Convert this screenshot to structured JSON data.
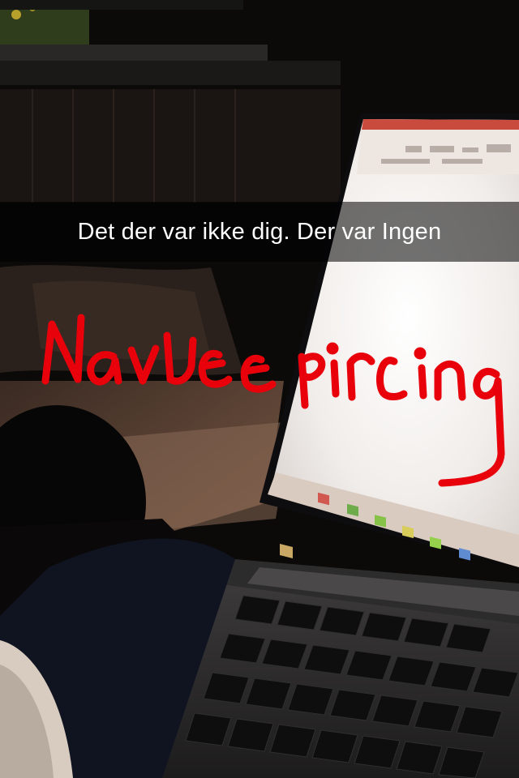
{
  "caption": {
    "text": "Det der var ikke dig. Der var Ingen"
  },
  "drawing": {
    "text": "Navlepircing",
    "color": "#e8000b"
  },
  "colors": {
    "screen_glow": "#f2eeea",
    "taskbar": "#d8ccbf",
    "caption_bg": "rgba(0,0,0,0.55)"
  }
}
